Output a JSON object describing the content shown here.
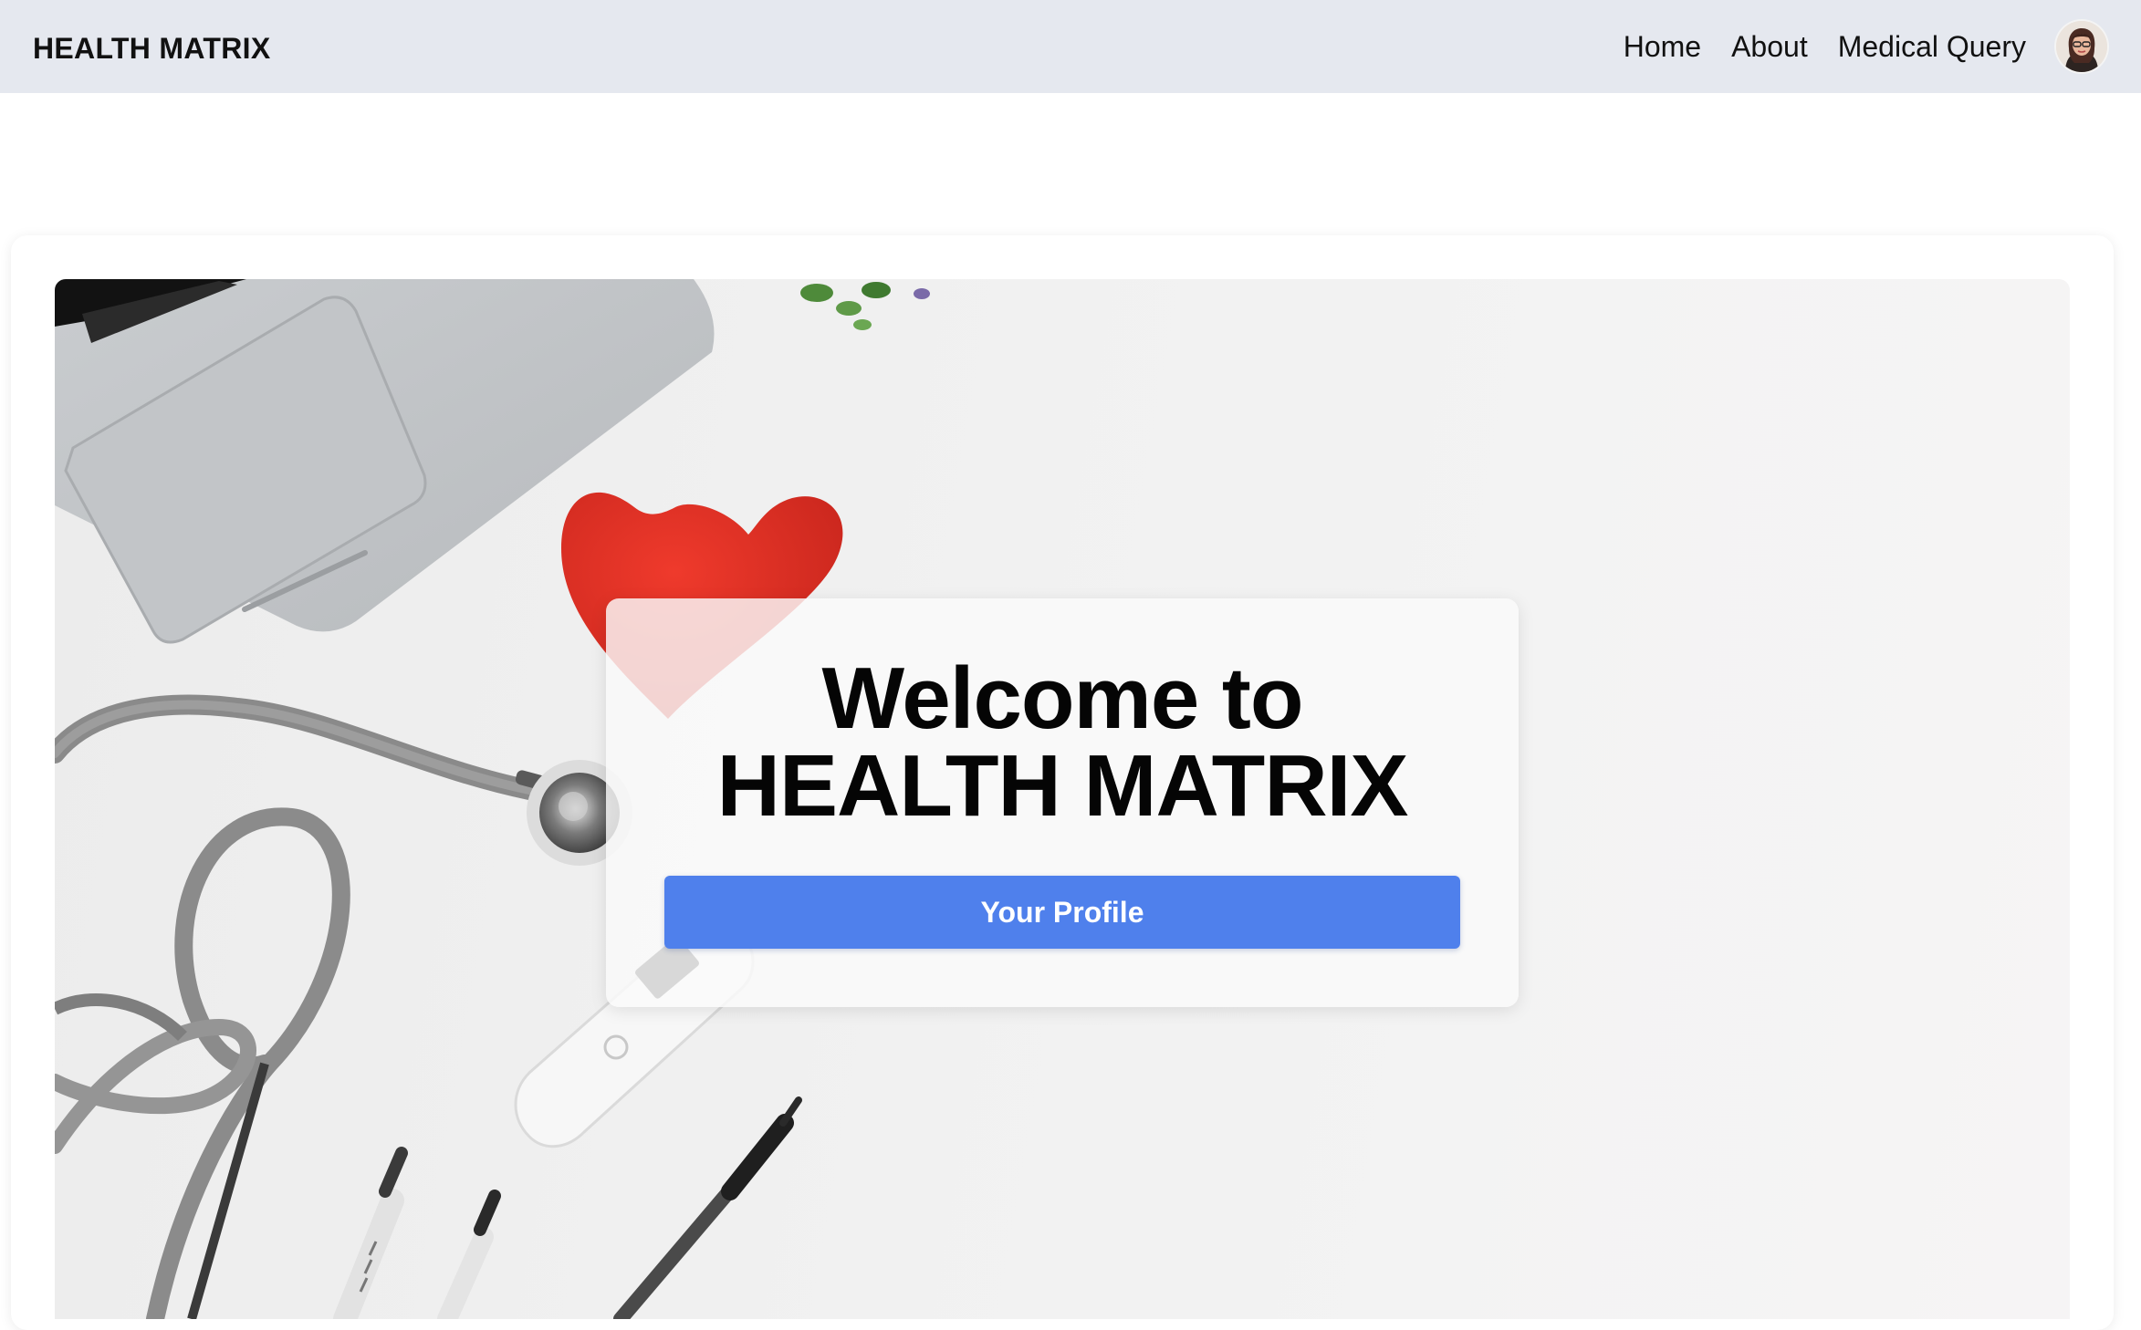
{
  "navbar": {
    "brand": "HEALTH MATRIX",
    "links": [
      {
        "label": "Home"
      },
      {
        "label": "About"
      },
      {
        "label": "Medical Query"
      }
    ],
    "avatar_icon": "user-avatar"
  },
  "hero": {
    "title_line1": "Welcome to",
    "title_line2": "HEALTH MATRIX",
    "profile_button": "Your Profile"
  },
  "colors": {
    "navbar_bg": "#e5e8ef",
    "button_bg": "#4f80ec",
    "heart": "#e2322a"
  }
}
